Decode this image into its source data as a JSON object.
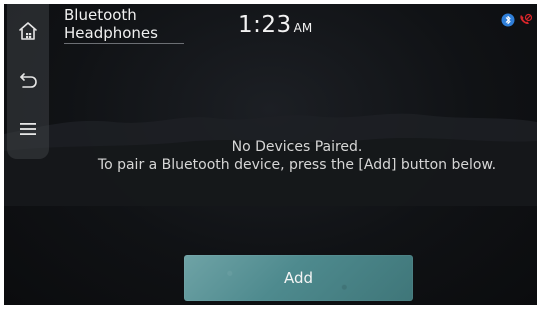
{
  "header": {
    "title_line1": "Bluetooth",
    "title_line2": "Headphones",
    "time": "1:23",
    "ampm": "AM"
  },
  "sidebar": {
    "items": [
      {
        "icon": "home-icon"
      },
      {
        "icon": "back-icon"
      },
      {
        "icon": "menu-icon"
      }
    ]
  },
  "status": {
    "icons": [
      "bluetooth-status-icon",
      "phone-status-icon"
    ],
    "colors": {
      "bluetooth": "#2f7fd9",
      "phone": "#d9252a"
    }
  },
  "main": {
    "message_line1": "No Devices Paired.",
    "message_line2": "To pair a Bluetooth device, press the [Add] button below.",
    "add_label": "Add"
  },
  "theme": {
    "accent": "#5a9396",
    "background": "#111316"
  }
}
